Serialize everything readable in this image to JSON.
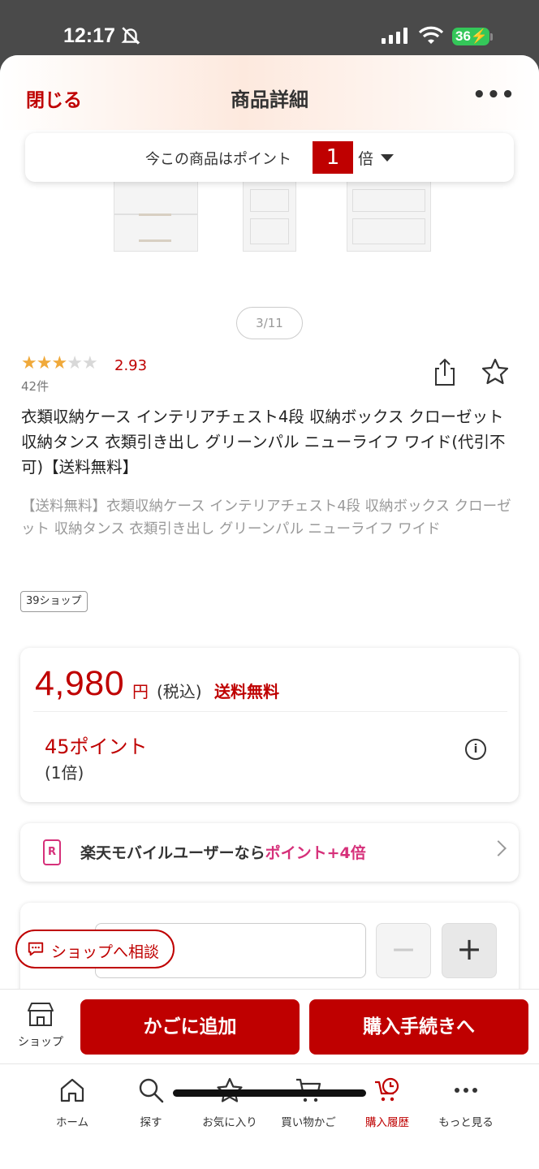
{
  "status_bar": {
    "time": "12:17",
    "battery": "36"
  },
  "header": {
    "close_label": "閉じる",
    "title": "商品詳細",
    "more_label": "•••"
  },
  "point_banner": {
    "text": "今この商品はポイント",
    "multiplier_value": "1",
    "multiplier_suffix": "倍"
  },
  "gallery": {
    "counter": "3/11"
  },
  "rating": {
    "stars": 2.93,
    "value": "2.93",
    "count": "42件"
  },
  "product": {
    "title": "衣類収納ケース インテリアチェスト4段 収納ボックス クローゼット 収納タンス 衣類引き出し グリーンパル ニューライフ ワイド(代引不可)【送料無料】",
    "subtitle": "【送料無料】衣類収納ケース インテリアチェスト4段 収納ボックス クローゼット 収納タンス 衣類引き出し グリーンパル ニューライフ ワイド",
    "badge": "39ショップ"
  },
  "price": {
    "amount": "4,980",
    "currency": "円",
    "tax": "(税込)",
    "shipping": "送料無料",
    "points": "45ポイント",
    "points_mult": "(1倍)"
  },
  "mobile_promo": {
    "icon_letter": "R",
    "text": "楽天モバイルユーザーなら",
    "highlight": "ポイント+4倍"
  },
  "quantity": {
    "minus": "−",
    "plus": "+"
  },
  "consult": {
    "label": "ショップへ相談"
  },
  "actions": {
    "shop_label": "ショップ",
    "cart_label": "かごに追加",
    "buy_label": "購入手続きへ"
  },
  "tabs": [
    {
      "label": "ホーム"
    },
    {
      "label": "探す"
    },
    {
      "label": "お気に入り"
    },
    {
      "label": "買い物かご"
    },
    {
      "label": "購入履歴"
    },
    {
      "label": "もっと見る"
    }
  ],
  "colors": {
    "brand_red": "#bf0000",
    "star": "#f0a93a",
    "mobile_pink": "#d6307a"
  }
}
